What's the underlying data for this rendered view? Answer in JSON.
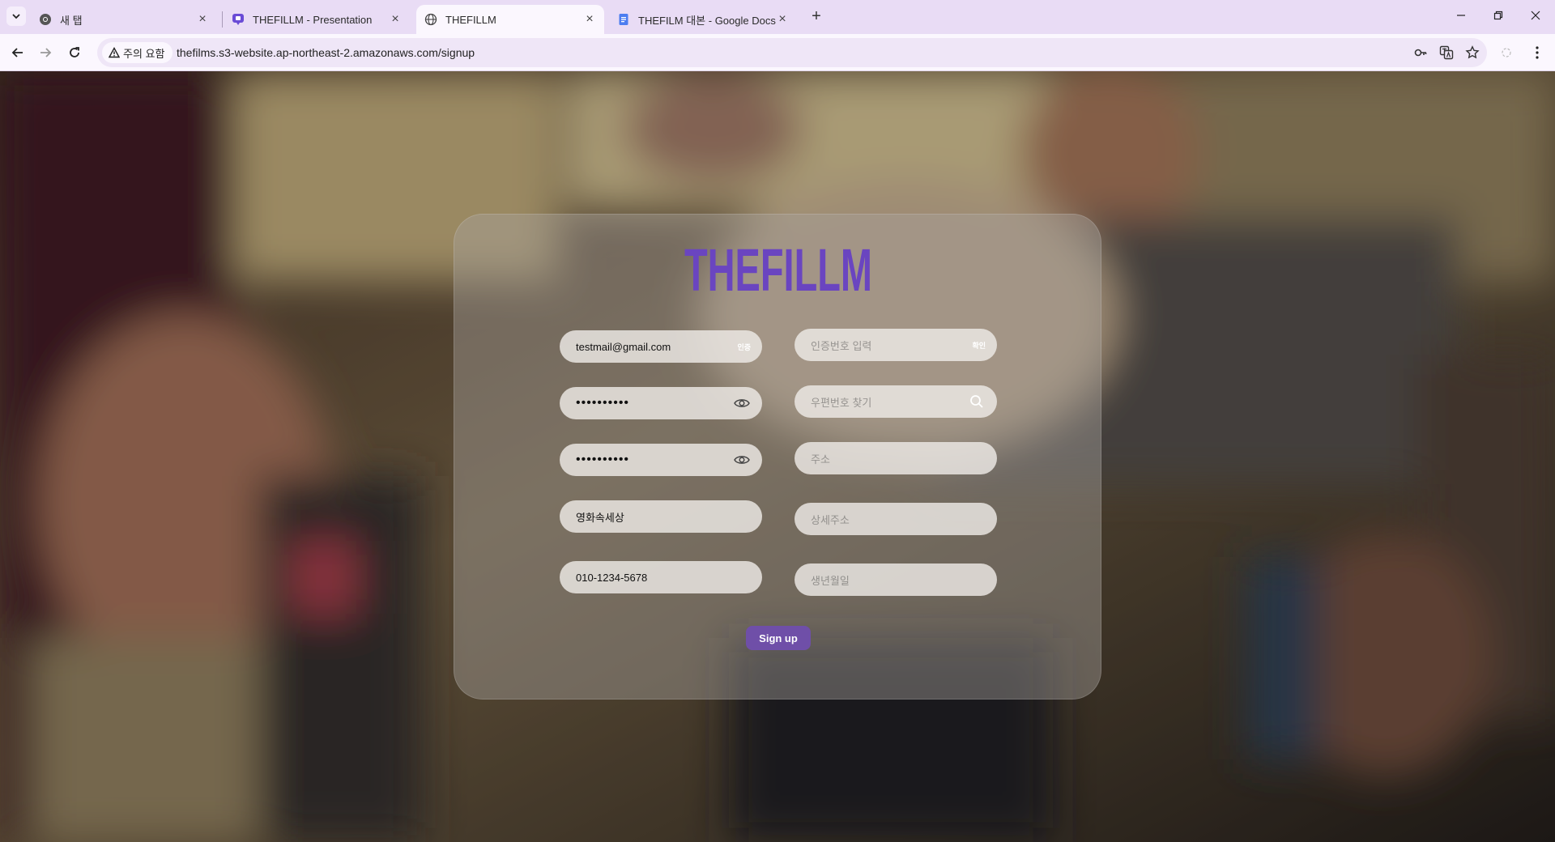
{
  "browser": {
    "tabs": [
      {
        "title": "새 탭",
        "icon": "chrome-icon"
      },
      {
        "title": "THEFILLM - Presentation",
        "icon": "presentation-icon"
      },
      {
        "title": "THEFILLM",
        "icon": "globe-icon"
      },
      {
        "title": "THEFILM 대본 - Google Docs",
        "icon": "docs-icon"
      }
    ],
    "security_label": "주의 요함",
    "url": "thefilms.s3-website.ap-northeast-2.amazonaws.com/signup"
  },
  "signup": {
    "logo": "THEFILLM",
    "email_value": "testmail@gmail.com",
    "email_verify_label": "인증",
    "code_placeholder": "인증번호 입력",
    "code_confirm_label": "확인",
    "password_mask": "••••••••••",
    "password_confirm_mask": "••••••••••",
    "zipcode_placeholder": "우편번호 찾기",
    "address_placeholder": "주소",
    "nickname_value": "영화속세상",
    "detail_address_placeholder": "상세주소",
    "phone_value": "010-1234-5678",
    "birthday_placeholder": "생년월일",
    "submit_label": "Sign up"
  },
  "colors": {
    "accent": "#6f4fa8",
    "logo": "#6a45c0",
    "tabstrip": "#e9dcf5"
  }
}
